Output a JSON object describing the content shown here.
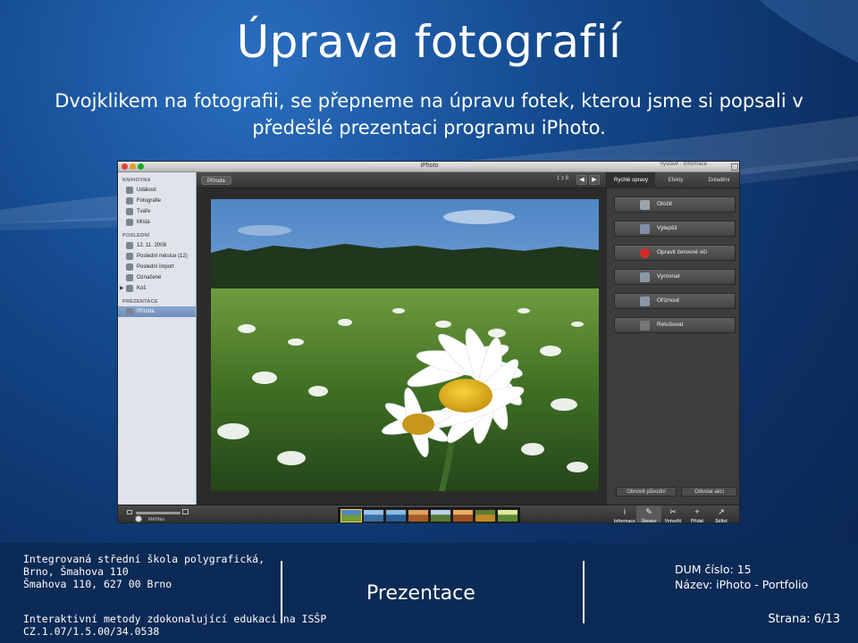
{
  "slide": {
    "title": "Úprava fotografií",
    "subtitle": "Dvojklikem na fotografii, se přepneme na úpravu fotek, kterou jsme si popsali v předešlé prezentaci programu iPhoto."
  },
  "colors": {
    "background": "#144a8e",
    "footer": "#0b2a55",
    "selection": "#6d8dba",
    "red_eye_icon": "#d42a2a",
    "highlight": "#ffd23c"
  },
  "app": {
    "window_title": "iPhoto",
    "top_right": "Vystavit · Informace",
    "sidebar": {
      "library_header": "KNIHOVNA",
      "library": [
        {
          "label": "Události",
          "icon": "events-icon"
        },
        {
          "label": "Fotografie",
          "icon": "photos-icon"
        },
        {
          "label": "Tváře",
          "icon": "faces-icon"
        },
        {
          "label": "Místa",
          "icon": "places-icon"
        }
      ],
      "recent_header": "POSLEDNÍ",
      "recent": [
        {
          "label": "12. 11. 2008",
          "icon": "event-icon"
        },
        {
          "label": "Poslední měsíce (12)",
          "icon": "calendar-icon"
        },
        {
          "label": "Poslední import",
          "icon": "import-icon"
        },
        {
          "label": "Označené",
          "icon": "flag-icon"
        },
        {
          "label": "Koš",
          "icon": "trash-icon"
        }
      ],
      "projects_header": "PREZENTACE",
      "projects": [
        {
          "label": "Příroda",
          "icon": "slideshow-icon"
        }
      ]
    },
    "toolbar": {
      "album_name": "Příroda",
      "counter": "1 z 8",
      "prev": "◀",
      "next": "▶"
    },
    "edit_panel": {
      "tabs": [
        "Rychlé opravy",
        "Efekty",
        "Doladění"
      ],
      "buttons": [
        {
          "label": "Otočit",
          "icon": "rotate-icon"
        },
        {
          "label": "Vylepšit",
          "icon": "enhance-icon"
        },
        {
          "label": "Opravit červené oči",
          "icon": "red-eye-icon"
        },
        {
          "label": "Vyrovnat",
          "icon": "straighten-icon"
        },
        {
          "label": "Oříznout",
          "icon": "crop-icon"
        },
        {
          "label": "Retušovat",
          "icon": "retouch-icon"
        }
      ],
      "revert_label": "Obnovit původní",
      "undo_label": "Odvolat akci"
    },
    "bottombar": {
      "zoom_label": "Měřítko",
      "zoom_level": 0.05,
      "thumbnail_count": 8,
      "selected_thumbnail": 1,
      "tools": [
        {
          "label": "Informace",
          "glyph": "i",
          "icon": "info-icon"
        },
        {
          "label": "Úpravy",
          "glyph": "✎",
          "icon": "edit-icon"
        },
        {
          "label": "Vytvořit",
          "glyph": "✂",
          "icon": "create-icon"
        },
        {
          "label": "Přidat",
          "glyph": "+",
          "icon": "add-icon"
        },
        {
          "label": "Sdílet",
          "glyph": "↗",
          "icon": "share-icon"
        }
      ]
    }
  },
  "footer": {
    "school_line1": "Integrovaná střední škola polygrafická,",
    "school_line2": "Brno, Šmahova 110",
    "school_line3": "Šmahova 110, 627 00 Brno",
    "project_line1": "Interaktivní metody zdokonalující edukaci na ISŠP",
    "project_line2": "CZ.1.07/1.5.00/34.0538",
    "center": "Prezentace",
    "dum": "DUM číslo: 15",
    "name": "Název: iPhoto - Portfolio",
    "page": "Strana: 6/13"
  }
}
